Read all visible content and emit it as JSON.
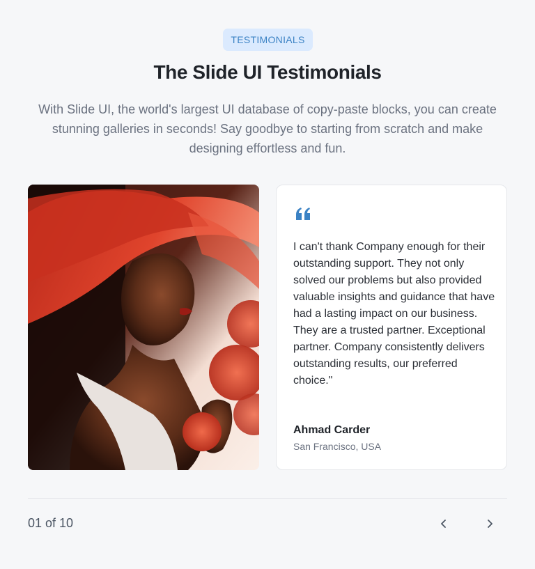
{
  "header": {
    "badge": "TESTIMONIALS",
    "title": "The Slide UI Testimonials",
    "subtitle": "With Slide UI, the world's largest UI database of copy-paste blocks, you can create stunning galleries in seconds! Say goodbye to starting from scratch and make designing effortless and fun."
  },
  "testimonial": {
    "quote": "I can't thank Company enough for their outstanding support. They not only solved our problems but also provided valuable insights and guidance that have had a lasting impact on our business. They are a trusted partner. Exceptional partner. Company consistently delivers outstanding results, our preferred choice.\"",
    "author_name": "Ahmad Carder",
    "author_location": "San Francisco, USA",
    "quote_icon": "quote-icon",
    "photo": "portrait-photo"
  },
  "pagination": {
    "counter": "01 of 10",
    "prev_icon": "chevron-left-icon",
    "next_icon": "chevron-right-icon"
  },
  "colors": {
    "accent": "#3b82c4",
    "badge_bg": "#dbeafe",
    "background": "#f6f7f9"
  }
}
